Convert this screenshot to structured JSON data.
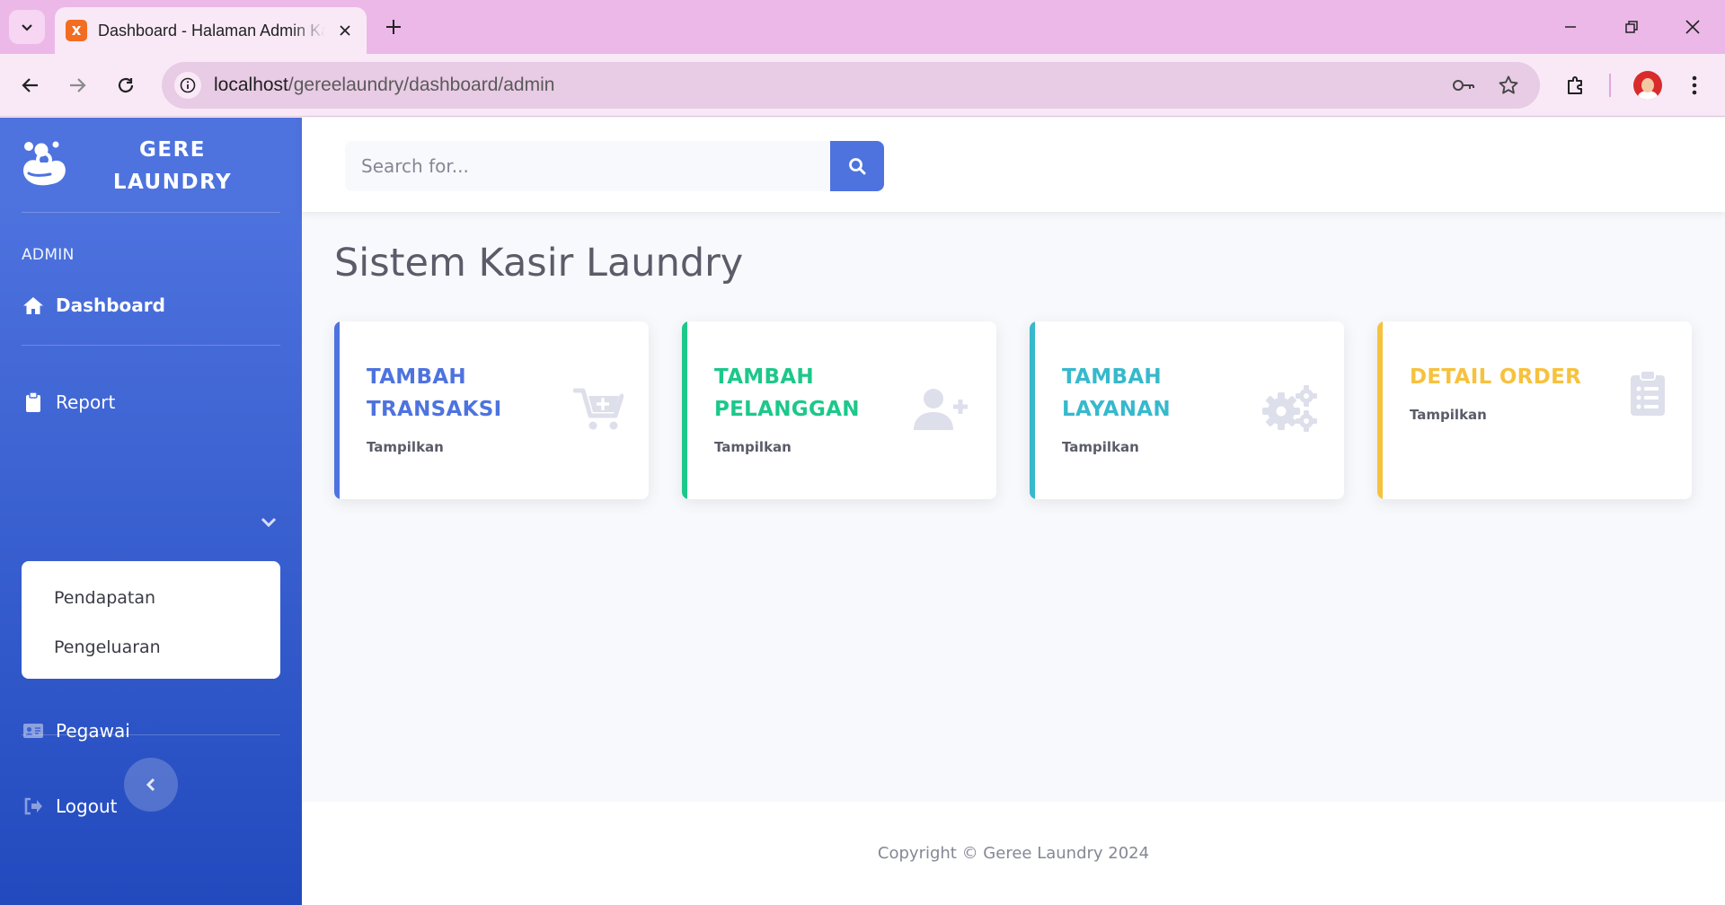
{
  "browser": {
    "tab_title": "Dashboard - Halaman Admin Kasir Laundry",
    "url_host": "localhost",
    "url_path": "/gereelaundry/dashboard/admin"
  },
  "sidebar": {
    "brand_line1": "GERE",
    "brand_line2": "LAUNDRY",
    "heading": "ADMIN",
    "items": [
      {
        "label": "Dashboard",
        "icon": "home-icon"
      },
      {
        "label": "Report",
        "icon": "clipboard-icon"
      },
      {
        "label": "Pegawai",
        "icon": "id-card-icon"
      },
      {
        "label": "Logout",
        "icon": "sign-out-icon"
      }
    ],
    "report_submenu": [
      "Pendapatan",
      "Pengeluaran"
    ]
  },
  "topbar": {
    "search_placeholder": "Search for..."
  },
  "main": {
    "title": "Sistem Kasir Laundry",
    "cards": [
      {
        "title": "TAMBAH TRANSAKSI",
        "sub": "Tampilkan",
        "color": "#4e73df",
        "icon": "cart-plus-icon"
      },
      {
        "title": "TAMBAH PELANGGAN",
        "sub": "Tampilkan",
        "color": "#1cc88a",
        "icon": "user-plus-icon"
      },
      {
        "title": "TAMBAH LAYANAN",
        "sub": "Tampilkan",
        "color": "#36b9cc",
        "icon": "cogs-icon"
      },
      {
        "title": "DETAIL ORDER",
        "sub": "Tampilkan",
        "color": "#f6c23e",
        "icon": "clipboard-list-icon"
      }
    ]
  },
  "footer": {
    "copyright": "Copyright © Geree Laundry 2024"
  }
}
